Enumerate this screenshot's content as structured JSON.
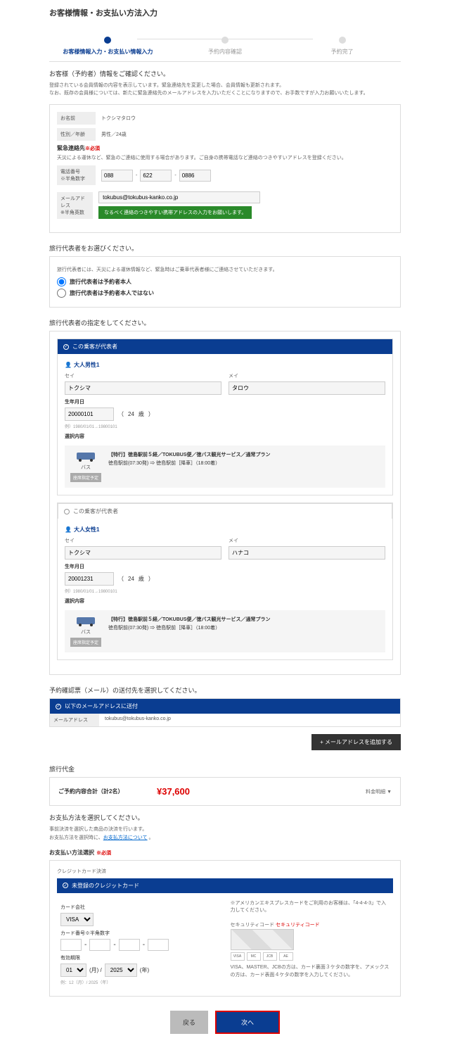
{
  "page_title": "お客様情報・お支払い方法入力",
  "steps": [
    "お客様情報入力・お支払い情報入力",
    "予約内容確認",
    "予約完了"
  ],
  "customer": {
    "heading": "お客様（予約者）情報をご確認ください。",
    "desc": "登録されている会員情報の内容を表示しています。緊急連絡先を変更した場合、会員情報も更新されます。\nなお、既存の会員様については、新たに緊急連絡先のメールアドレスを入力いただくことになりますので、お手数ですが入力お願いいたします。",
    "name_label": "お名前",
    "name_value": "トクシマタロウ",
    "gender_label": "性別／年齢",
    "gender_value": "男性／24歳",
    "emergency_label": "緊急連絡先",
    "required": "※必須",
    "emergency_desc": "天災による運休など、緊急のご連絡に使用する場合があります。ご自身の携帯電話など連絡のつきやすいアドレスを登録ください。",
    "tel_label": "電話番号\n※半角数字",
    "tel": [
      "088",
      "622",
      "0886"
    ],
    "email_label": "メールアドレス\n※半角英数",
    "email_value": "tokubus@tokubus-kanko.co.jp",
    "green_msg": "なるべく連絡のつきやすい携帯アドレスの入力をお願いします。"
  },
  "rep": {
    "heading": "旅行代表者をお選びください。",
    "desc": "旅行代表者には、天災による運休情報など、緊急時はご乗車代表者様にご連絡させていただきます。",
    "opt1": "旅行代表者は予約者本人",
    "opt2": "旅行代表者は予約者本人ではない"
  },
  "assign": {
    "heading": "旅行代表者の指定をしてください。",
    "header_on": "この乗客が代表者",
    "header_off": "この乗客が代表者",
    "sei_label": "セイ",
    "mei_label": "メイ",
    "birth_label": "生年月日",
    "age_suffix": "歳",
    "birth_hint": "例）1980/01/01→19800101",
    "trip_label": "選択内容",
    "bus_label": "バス",
    "seat_btn": "座席指定予定",
    "trip_title": "【特行】徳島駅前５経／TOKUBUS便／徳バス観光サービス／通常プラン",
    "p1": {
      "title": "大人男性1",
      "sei": "トクシマ",
      "mei": "タロウ",
      "birth": "20000101",
      "age": "24",
      "trip_detail": "徳島駅前(07:30発) ⇒ 徳島駅前［降車］（18:00着）"
    },
    "p2": {
      "title": "大人女性1",
      "sei": "トクシマ",
      "mei": "ハナコ",
      "birth": "20001231",
      "age": "24",
      "trip_detail": "徳島駅前(07:30発) ⇒ 徳島駅前［降車］（18:00着）"
    }
  },
  "confirm_email": {
    "heading": "予約確認票（メール）の送付先を選択してください。",
    "header": "以下のメールアドレスに送付",
    "label": "メールアドレス",
    "value": "tokubus@tokubus-kanko.co.jp",
    "add_btn": "メールアドレスを追加する"
  },
  "price": {
    "heading": "旅行代金",
    "label": "ご予約内容合計（計2名）",
    "value": "¥37,600",
    "detail": "料金明細 ▼"
  },
  "payment": {
    "heading": "お支払方法を選択してください。",
    "desc1": "事前決済を選択した商品の決済を行います。",
    "desc2_pre": "お支払方法を選択時に、",
    "desc2_link": "お支払方法について",
    "desc2_post": " 。",
    "select_label": "お支払い方法選択",
    "required": "※必須",
    "cc_section_label": "クレジットカード決済",
    "cc_header": "未登録のクレジットカード",
    "card_company_label": "カード会社",
    "card_company": "VISA",
    "card_num_label": "カード番号※半角数字",
    "expiry_label": "有効期限",
    "month": "01",
    "year": "2025",
    "month_unit": "(月) /",
    "year_unit": "(年)",
    "expiry_hint": "例：12（月）/ 2025（年）",
    "amex_note": "※アメリカンエキスプレスカードをご利用のお客様は、「4-4-4-3」で入力してください。",
    "sec_label": "セキュリティコード",
    "sec_code_label": "セキュリティコード",
    "sec_note": "VISA、MASTER、JCBの方は、カード裏面３ケタの数字を、アメックスの方は、カード表面４ケタの数字を入力してください。"
  },
  "buttons": {
    "back": "戻る",
    "next": "次へ"
  }
}
